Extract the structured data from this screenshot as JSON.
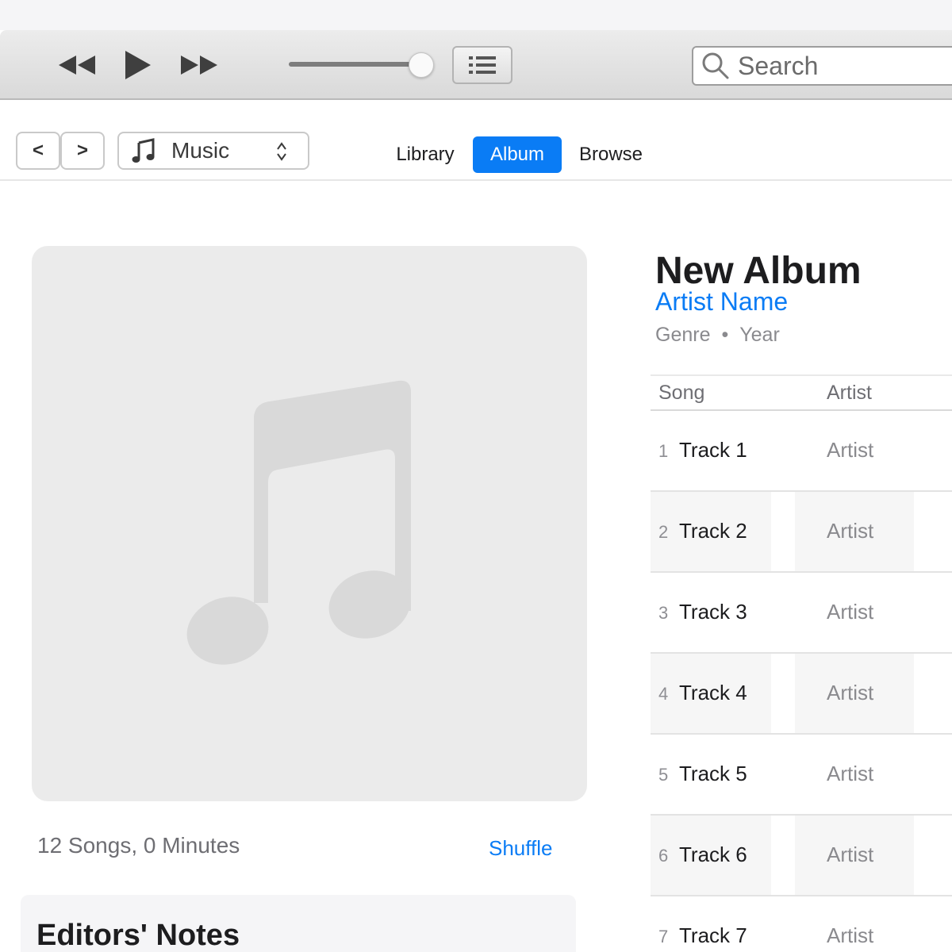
{
  "toolbar": {
    "volume_level": 0.93,
    "search": {
      "placeholder": "Search",
      "value": ""
    }
  },
  "nav": {
    "back_label": "<",
    "forward_label": ">",
    "source": {
      "label": "Music"
    },
    "tabs": [
      {
        "label": "Library",
        "active": false
      },
      {
        "label": "Album",
        "active": true
      },
      {
        "label": "Browse",
        "active": false
      }
    ]
  },
  "album": {
    "title": "New Album",
    "artist": "Artist Name",
    "genre": "Genre",
    "separator": "•",
    "year": "Year",
    "summary": "12 Songs, 0 Minutes",
    "shuffle_label": "Shuffle",
    "notes_title": "Editors' Notes"
  },
  "table": {
    "headers": {
      "song": "Song",
      "artist": "Artist"
    },
    "rows": [
      {
        "num": "1",
        "song": "Track 1",
        "artist": "Artist"
      },
      {
        "num": "2",
        "song": "Track 2",
        "artist": "Artist"
      },
      {
        "num": "3",
        "song": "Track 3",
        "artist": "Artist"
      },
      {
        "num": "4",
        "song": "Track 4",
        "artist": "Artist"
      },
      {
        "num": "5",
        "song": "Track 5",
        "artist": "Artist"
      },
      {
        "num": "6",
        "song": "Track 6",
        "artist": "Artist"
      },
      {
        "num": "7",
        "song": "Track 7",
        "artist": "Artist"
      }
    ]
  },
  "colors": {
    "accent": "#0a7cf5",
    "artwork_bg": "#ebebeb",
    "artwork_glyph": "#d9d9d9"
  },
  "icons": {
    "rewind": "rewind-icon",
    "play": "play-icon",
    "fast_forward": "fast-forward-icon",
    "list": "list-icon",
    "search": "search-icon",
    "music_note": "music-note-icon",
    "up_down": "up-down-chevron-icon"
  }
}
